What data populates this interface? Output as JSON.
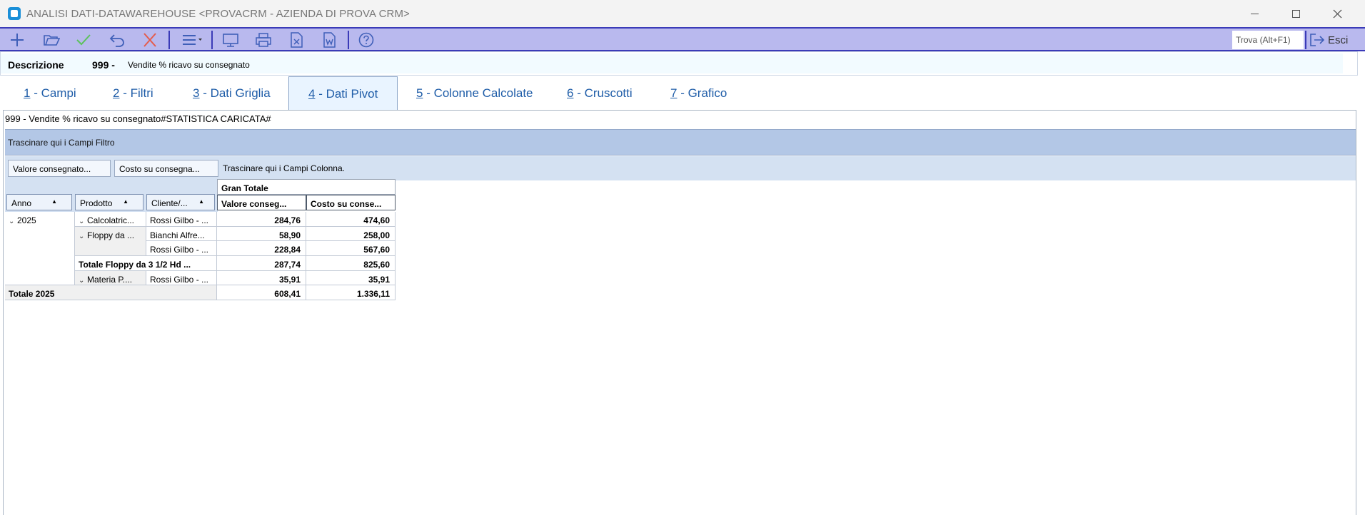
{
  "window": {
    "title": "ANALISI DATI-DATAWAREHOUSE <PROVACRM - AZIENDA DI PROVA CRM>"
  },
  "toolbar": {
    "buttons": [
      "add-icon",
      "open-folder-icon",
      "confirm-check-icon",
      "undo-icon",
      "delete-x-icon",
      "menu-icon",
      "monitor-icon",
      "print-icon",
      "excel-icon",
      "word-icon",
      "help-icon"
    ],
    "search_label": "Trova (Alt+F1)",
    "exit_label": "Esci",
    "colors": {
      "bar": "#b9b9ee",
      "accent": "#3b3bb8",
      "check": "#5cc25c",
      "delete": "#e55b4b"
    }
  },
  "description": {
    "label": "Descrizione",
    "code": "999 -",
    "value": "Vendite % ricavo su consegnato"
  },
  "tabs": [
    {
      "key": "1",
      "label": " - Campi",
      "active": false
    },
    {
      "key": "2",
      "label": " - Filtri",
      "active": false
    },
    {
      "key": "3",
      "label": " - Dati Griglia",
      "active": false
    },
    {
      "key": "4",
      "label": " - Dati Pivot",
      "active": true
    },
    {
      "key": "5",
      "label": " - Colonne Calcolate",
      "active": false
    },
    {
      "key": "6",
      "label": " - Cruscotti",
      "active": false
    },
    {
      "key": "7",
      "label": " - Grafico",
      "active": false
    }
  ],
  "pivot": {
    "title": "999 - Vendite % ricavo su consegnato#STATISTICA CARICATA#",
    "filter_hint": "Trascinare qui i Campi Filtro",
    "data_fields": [
      "Valore consegnato...",
      "Costo su consegna..."
    ],
    "column_hint": "Trascinare qui i Campi Colonna.",
    "row_fields": [
      "Anno",
      "Prodotto",
      "Cliente/..."
    ],
    "grand_total_header": "Gran Totale",
    "value_headers": [
      "Valore conseg...",
      "Costo su conse..."
    ],
    "rows": [
      {
        "anno": "2025",
        "prodotto": "Calcolatric...",
        "cliente": "Rossi Gilbo - ...",
        "v1": "284,76",
        "v2": "474,60"
      },
      {
        "prodotto": "Floppy da ...",
        "cliente": "Bianchi Alfre...",
        "v1": "58,90",
        "v2": "258,00"
      },
      {
        "cliente": "Rossi Gilbo - ...",
        "v1": "228,84",
        "v2": "567,60"
      },
      {
        "subtotal": "Totale Floppy da 3 1/2 Hd ...",
        "v1": "287,74",
        "v2": "825,60"
      },
      {
        "prodotto": "Materia P....",
        "cliente": "Rossi Gilbo - ...",
        "v1": "35,91",
        "v2": "35,91"
      },
      {
        "total": "Totale 2025",
        "v1": "608,41",
        "v2": "1.336,11"
      }
    ]
  }
}
